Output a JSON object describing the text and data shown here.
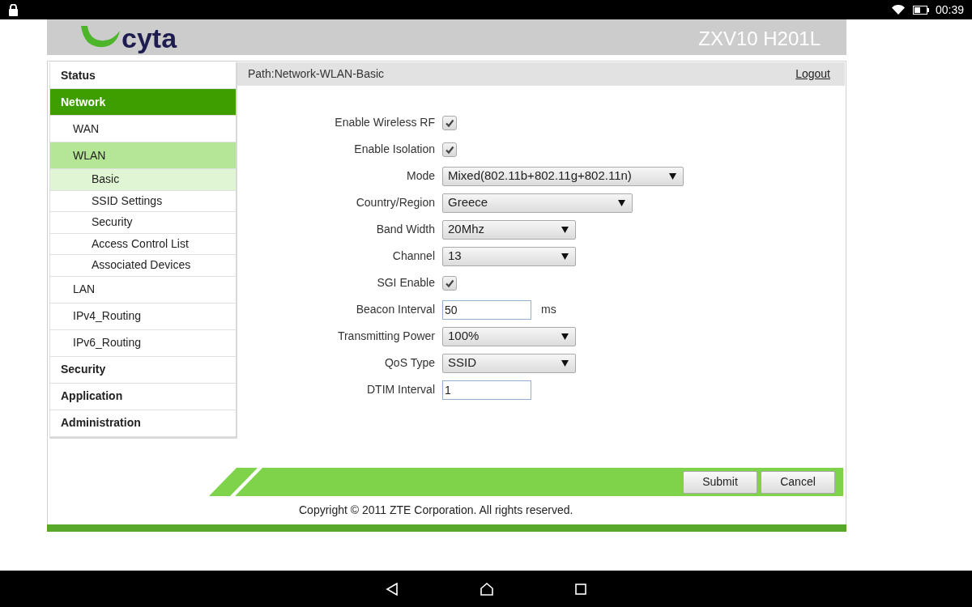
{
  "status_bar": {
    "time": "00:39"
  },
  "header": {
    "logo": "cyta",
    "model": "ZXV10 H201L"
  },
  "sidebar": {
    "items": [
      {
        "label": "Status",
        "selected": false
      },
      {
        "label": "Network",
        "selected": true,
        "children": [
          {
            "label": "WAN",
            "selected": false
          },
          {
            "label": "WLAN",
            "selected": true,
            "children": [
              {
                "label": "Basic",
                "selected": true
              },
              {
                "label": "SSID Settings",
                "selected": false
              },
              {
                "label": "Security",
                "selected": false
              },
              {
                "label": "Access Control List",
                "selected": false
              },
              {
                "label": "Associated Devices",
                "selected": false
              }
            ]
          },
          {
            "label": "LAN",
            "selected": false
          },
          {
            "label": "IPv4_Routing",
            "selected": false
          },
          {
            "label": "IPv6_Routing",
            "selected": false
          }
        ]
      },
      {
        "label": "Security",
        "selected": false
      },
      {
        "label": "Application",
        "selected": false
      },
      {
        "label": "Administration",
        "selected": false
      }
    ]
  },
  "content": {
    "path": "Path:Network-WLAN-Basic",
    "logout": "Logout",
    "fields": [
      {
        "kind": "checkbox",
        "label": "Enable Wireless RF",
        "checked": true
      },
      {
        "kind": "checkbox",
        "label": "Enable Isolation",
        "checked": true
      },
      {
        "kind": "select",
        "label": "Mode",
        "value": "Mixed(802.11b+802.11g+802.11n)"
      },
      {
        "kind": "select",
        "label": "Country/Region",
        "value": "Greece"
      },
      {
        "kind": "select",
        "label": "Band Width",
        "value": "20Mhz"
      },
      {
        "kind": "select",
        "label": "Channel",
        "value": "13"
      },
      {
        "kind": "checkbox",
        "label": "SGI Enable",
        "checked": true
      },
      {
        "kind": "text",
        "label": "Beacon Interval",
        "value": "50",
        "unit": "ms"
      },
      {
        "kind": "select",
        "label": "Transmitting Power",
        "value": "100%"
      },
      {
        "kind": "select",
        "label": "QoS Type",
        "value": "SSID"
      },
      {
        "kind": "text",
        "label": "DTIM Interval",
        "value": "1"
      }
    ]
  },
  "footer": {
    "buttons": [
      "Submit",
      "Cancel"
    ],
    "copyright": "Copyright © 2011 ZTE Corporation. All rights reserved."
  }
}
